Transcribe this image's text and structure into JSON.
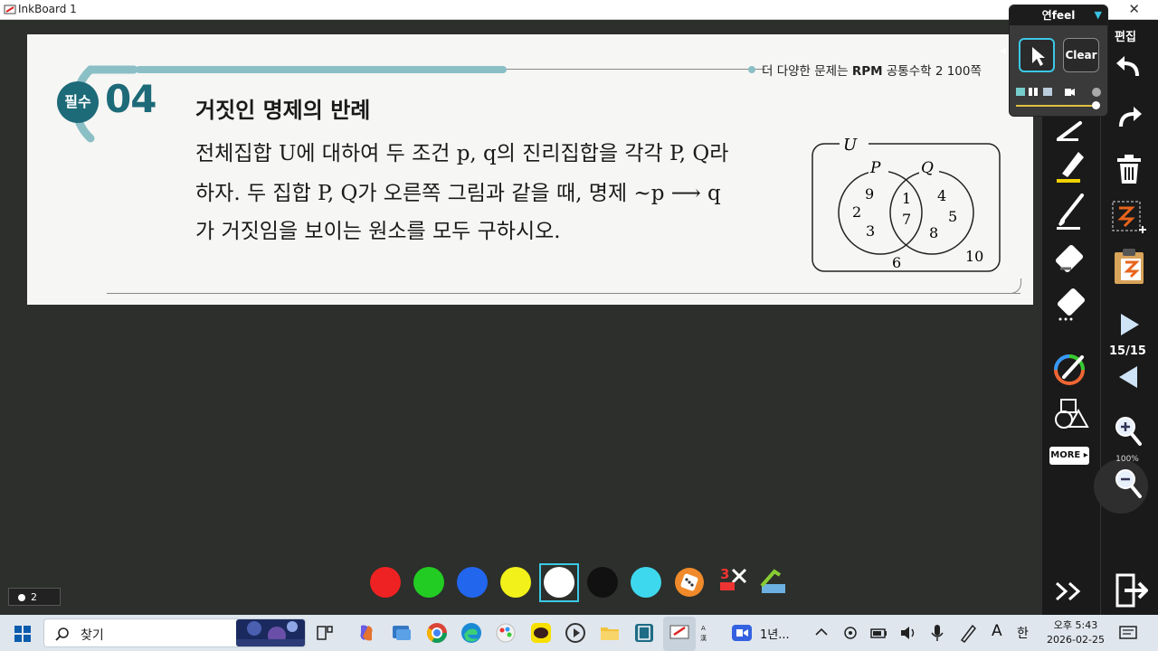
{
  "window": {
    "title": "InkBoard 1",
    "close_glyph": "✕"
  },
  "problem": {
    "reference_prefix": "더 다양한 문제는",
    "reference_book": "RPM",
    "reference_suffix": "공통수학 2  100쪽",
    "badge": "필수",
    "number": "04",
    "title": "거짓인 명제의 반례",
    "line1": "전체집합 U에 대하여 두 조건 p, q의 진리집합을 각각 P, Q라",
    "line2": "하자. 두 집합 P, Q가 오른쪽 그림과 같을 때, 명제 ~p ⟶ q",
    "line3": "가 거짓임을 보이는 원소를 모두 구하시오.",
    "venn": {
      "universe": "U",
      "set_p": "P",
      "set_q": "Q",
      "p_only": [
        "9",
        "2",
        "3"
      ],
      "both": [
        "1",
        "7"
      ],
      "q_only": [
        "4",
        "5",
        "8"
      ],
      "outside": [
        "6",
        "10"
      ]
    }
  },
  "pen_panel": {
    "title": "연feel",
    "clear_label": "Clear"
  },
  "nav": {
    "edit_label": "편집",
    "page_count": "15/15",
    "zoom": "100%",
    "more_label": "MORE"
  },
  "colors": [
    "#ee2222",
    "#22cc22",
    "#2266ee",
    "#f2f21a",
    "#ffffff",
    "#111111",
    "#3ed8ee"
  ],
  "page_indicator": {
    "value": "2"
  },
  "taskbar": {
    "search_placeholder": "찾기",
    "zoom_app": "1년...",
    "clock_line1": "오후 5:43",
    "clock_line2": "2026-02-25",
    "ime_a": "A",
    "ime_han": "한"
  }
}
